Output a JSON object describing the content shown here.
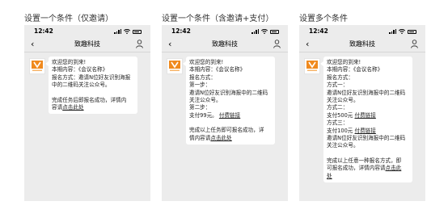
{
  "captions": [
    "设置一个条件（仅邀请）",
    "设置一个条件（含邀请+支付）",
    "设置多个条件"
  ],
  "status": {
    "time": "12:42"
  },
  "nav": {
    "title": "致趣科技",
    "back_glyph": "‹"
  },
  "colors": {
    "phone_bg": "#ececec",
    "bubble_bg": "#ffffff",
    "logo": "#f08a1e"
  },
  "icons": {
    "back": "back-chevron-icon",
    "user": "user-icon",
    "signal": "signal-icon",
    "wifi": "wifi-icon",
    "battery": "battery-icon"
  },
  "chat1": {
    "l1": "欢迎您的到来!",
    "l2": "本期内容：《会议名称》",
    "l3": "报名方式：邀请N位好友识别海报",
    "l4": "中的二维码关注公众号。",
    "l5": "完成任务后即报名成功，详情内",
    "l6_pre": "容请",
    "l6_link": "点击此处"
  },
  "chat2": {
    "l1": "欢迎您的到来!",
    "l2": "本期内容：《会议名称》",
    "l3": "报名方式：",
    "l4": "第一步：",
    "l5": "邀请N位好友识别海报中的二维码",
    "l6": "关注公众号。",
    "l7": "第二步：",
    "l8_pre": "支付99元。",
    "l8_link": "付费链接",
    "l9": "完成以上任务即可报名成功，详",
    "l10_pre": "情内容请",
    "l10_link": "点击此处"
  },
  "chat3": {
    "l1": "欢迎您的到来!",
    "l2": "本期内容：《会议名称》",
    "l3": "报名方式：",
    "l4": "方式一：",
    "l5": "邀请N位好友识别海报中的二维码",
    "l6": "关注公众号。",
    "l7": "方式二：",
    "l8_pre": "支付500元",
    "l8_link": "付费链接",
    "l9": "方式三：",
    "l10_pre": "支付100元",
    "l10_link": "付费链接",
    "l11": "邀请N位好友识别海报中的二维码",
    "l12": "关注公众号。",
    "l13": "完成以上任意一种报名方式，即",
    "l14_pre": "可报名成功，详情内容请",
    "l14_link": "点击此",
    "l15": "处"
  }
}
